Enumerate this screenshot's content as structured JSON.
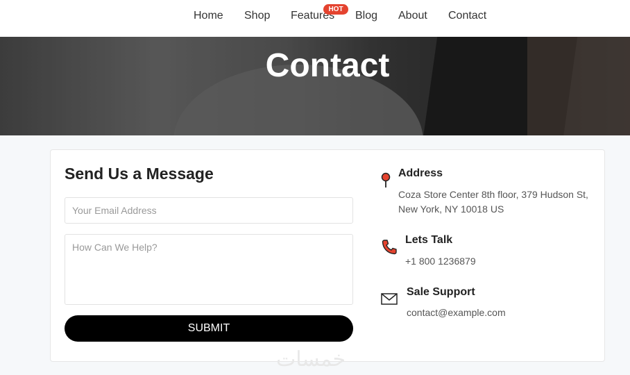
{
  "nav": {
    "items": [
      {
        "label": "Home"
      },
      {
        "label": "Shop"
      },
      {
        "label": "Features"
      },
      {
        "label": "Blog"
      },
      {
        "label": "About"
      },
      {
        "label": "Contact"
      }
    ],
    "badge": "HOT"
  },
  "hero": {
    "title": "Contact"
  },
  "form": {
    "title": "Send Us a Message",
    "email_placeholder": "Your Email Address",
    "message_placeholder": "How Can We Help?",
    "submit_label": "SUBMIT"
  },
  "info": {
    "address": {
      "heading": "Address",
      "line1": "Coza Store Center 8th floor, 379 Hudson St,",
      "line2": "New York, NY 10018 US"
    },
    "talk": {
      "heading": "Lets Talk",
      "phone": "+1 800 1236879"
    },
    "support": {
      "heading": "Sale Support",
      "email": "contact@example.com"
    }
  },
  "watermark": "خمسات",
  "colors": {
    "accent": "#e4432f",
    "button": "#000000"
  },
  "icons": [
    "map-pin-icon",
    "phone-icon",
    "envelope-icon"
  ]
}
